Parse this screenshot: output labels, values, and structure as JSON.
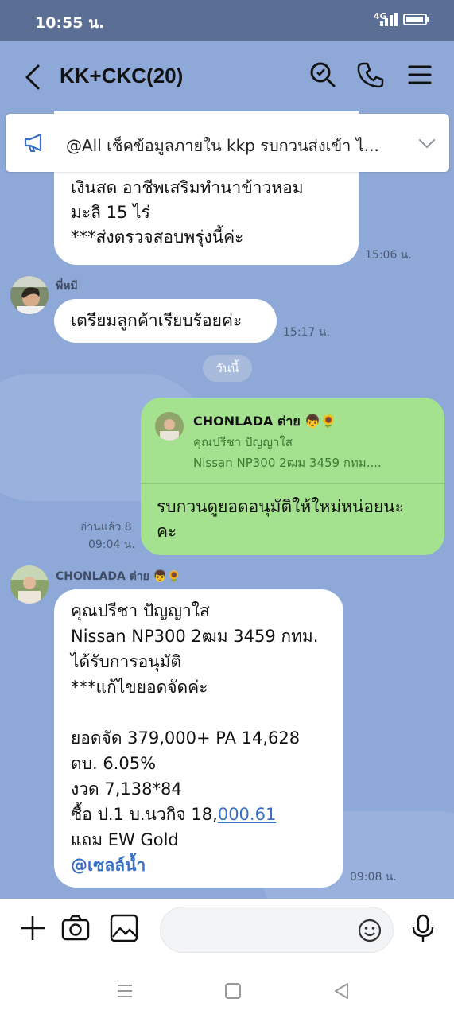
{
  "status": {
    "time": "10:55 น.",
    "network": "4G"
  },
  "header": {
    "title": "KK+CKC(20)"
  },
  "announcement": {
    "text": "@All  เช็คข้อมูลภายใน kkp รบกวนส่งเข้า ไ..."
  },
  "messages": {
    "m1": {
      "lines": [
        "เงินสด อาชีพเสริมทำนาข้าวหอม",
        "มะลิ 15 ไร่",
        "***ส่งตรวจสอบพรุ่งนี้ค่ะ"
      ],
      "time": "15:06 น."
    },
    "m2": {
      "sender": "พี่หมี",
      "text": "เตรียมลูกค้าเรียบร้อยค่ะ",
      "time": "15:17 น."
    },
    "date_divider": "วันนี้",
    "m3": {
      "quote_sender": "CHONLADA ต่าย 👦🌻",
      "quote_line1": "คุณปรีชา ปัญญาใส",
      "quote_line2": "Nissan NP300 2ฒม 3459 กทม....",
      "lines": [
        "รบกวนดูยอดอนุมัติให้ใหม่หน่อยนะ",
        "คะ"
      ],
      "read": "อ่านแล้ว 8",
      "time": "09:04 น."
    },
    "m4": {
      "sender": "CHONLADA ต่าย 👦🌻",
      "lines": [
        "คุณปรีชา ปัญญาใส",
        "Nissan NP300 2ฒม 3459 กทม.",
        "ได้รับการอนุมัติ",
        "***แก้ไขยอดจัดค่ะ",
        "",
        "ยอดจัด 379,000+ PA 14,628",
        "ดบ. 6.05%",
        "งวด 7,138*84"
      ],
      "buy_prefix": "ซื้อ ป.1 บ.นวกิจ 18,",
      "buy_link": "000.61",
      "gift": "แถม EW Gold",
      "mention": "@เซลล์น้ำ",
      "time": "09:08 น."
    }
  },
  "icons": {
    "back": "chevron-left-icon",
    "search": "search-icon",
    "call": "phone-icon",
    "menu": "hamburger-menu-icon",
    "megaphone": "megaphone-icon",
    "expand": "chevron-down-icon",
    "add": "plus-icon",
    "camera": "camera-icon",
    "gallery": "image-icon",
    "emoji": "emoji-icon",
    "mic": "microphone-icon"
  },
  "colors": {
    "chat_bg": "#8ea9d8",
    "my_bubble": "#a5e28f",
    "link": "#3a6fc7"
  }
}
